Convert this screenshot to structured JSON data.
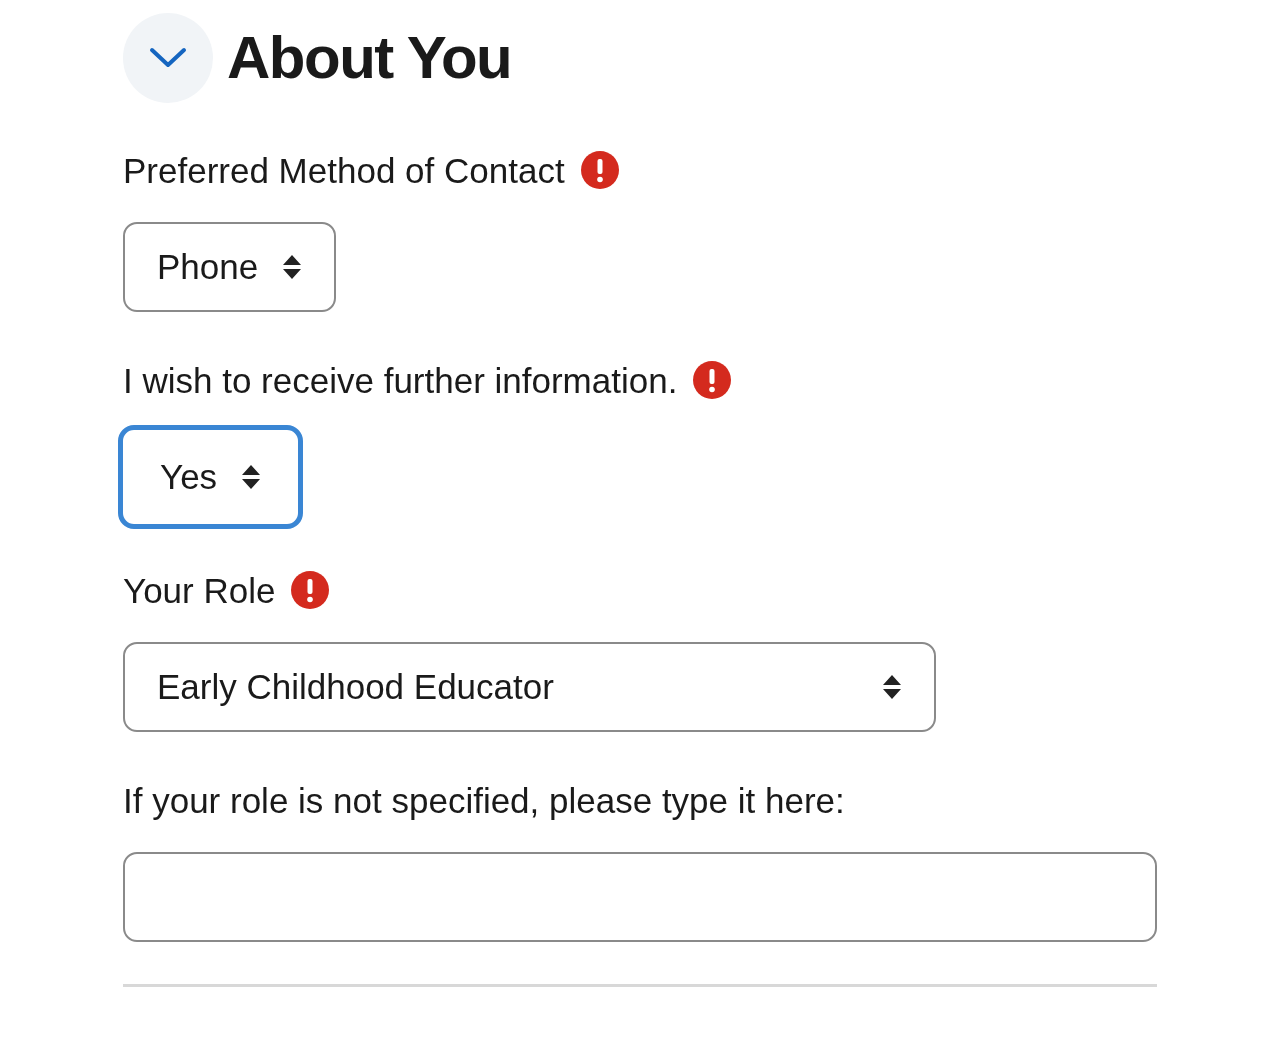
{
  "section": {
    "title": "About You",
    "expanded": true
  },
  "fields": [
    {
      "kind": "select",
      "label": "Preferred Method of Contact",
      "required": true,
      "value": "Phone",
      "focused": false,
      "wide": false
    },
    {
      "kind": "select",
      "label": "I wish to receive further information.",
      "required": true,
      "value": "Yes",
      "focused": true,
      "wide": false
    },
    {
      "kind": "select",
      "label": "Your Role",
      "required": true,
      "value": "Early Childhood Educator",
      "focused": false,
      "wide": true
    },
    {
      "kind": "text",
      "label": "If your role is not specified, please type it here:",
      "required": false,
      "focused": false
    }
  ]
}
